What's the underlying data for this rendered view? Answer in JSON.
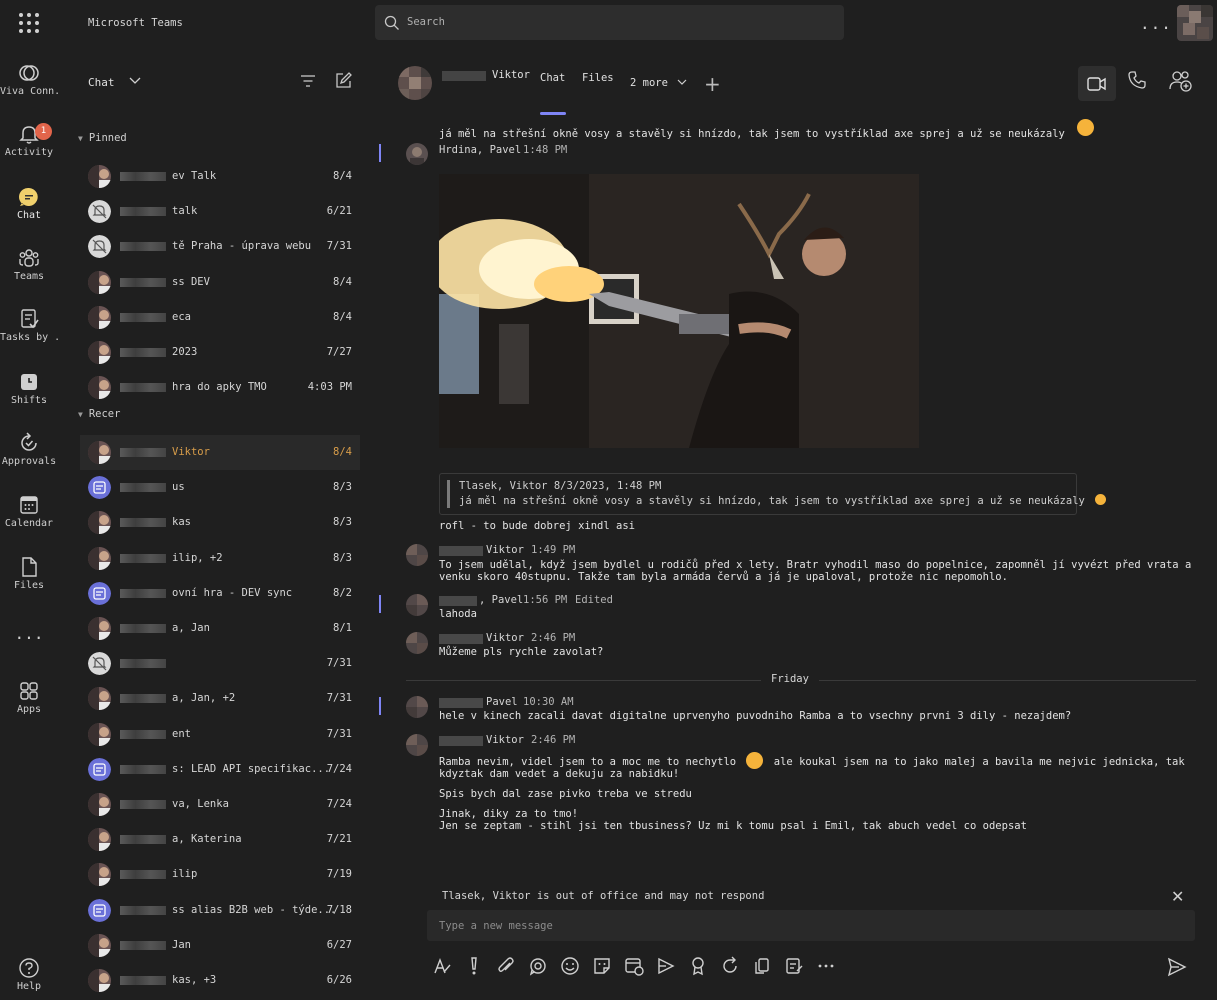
{
  "app": {
    "name": "Microsoft Teams"
  },
  "search": {
    "placeholder": "Search"
  },
  "topbar": {
    "more": "..."
  },
  "rail": {
    "viva": "Viva Conn...",
    "activity": "Activity",
    "activity_badge": "1",
    "chat": "Chat",
    "teams": "Teams",
    "tasks": "Tasks by ...",
    "shifts": "Shifts",
    "approvals": "Approvals",
    "calendar": "Calendar",
    "files": "Files",
    "more": "...",
    "apps": "Apps",
    "help": "Help"
  },
  "chat_list": {
    "header": "Chat",
    "pinned_label": "Pinned",
    "recent_label": "Recer",
    "pinned": [
      {
        "name": "ev Talk",
        "date": "8/4"
      },
      {
        "name": "talk",
        "date": "6/21"
      },
      {
        "name": "tě Praha - úprava webu",
        "date": "7/31"
      },
      {
        "name": "ss DEV",
        "date": "8/4"
      },
      {
        "name": "eca",
        "date": "8/4"
      },
      {
        "name": "2023",
        "date": "7/27"
      },
      {
        "name": "hra do apky TMO",
        "date": "4:03 PM"
      }
    ],
    "recent": [
      {
        "name": "Viktor",
        "date": "8/4"
      },
      {
        "name": "us",
        "date": "8/3"
      },
      {
        "name": "kas",
        "date": "8/3"
      },
      {
        "name": "ilip, +2",
        "date": "8/3"
      },
      {
        "name": "ovní hra - DEV sync",
        "date": "8/2"
      },
      {
        "name": "a, Jan",
        "date": "8/1"
      },
      {
        "name": "",
        "date": "7/31"
      },
      {
        "name": "a, Jan, +2",
        "date": "7/31"
      },
      {
        "name": "ent",
        "date": "7/31"
      },
      {
        "name": "s: LEAD API specifikac...",
        "date": "7/24"
      },
      {
        "name": "va, Lenka",
        "date": "7/24"
      },
      {
        "name": "a, Katerina",
        "date": "7/21"
      },
      {
        "name": "ilip",
        "date": "7/19"
      },
      {
        "name": "ss alias B2B web - týde...",
        "date": "7/18"
      },
      {
        "name": "Jan",
        "date": "6/27"
      },
      {
        "name": "kas, +3",
        "date": "6/26"
      }
    ]
  },
  "chat_header": {
    "name": "Viktor",
    "tabs": {
      "chat": "Chat",
      "files": "Files",
      "more": "2 more"
    }
  },
  "messages": {
    "top_line": "já měl na střešní okně vosy a stavěly si hnízdo, tak jsem to vystříklad axe sprej a už se neukázaly",
    "m1": {
      "sender": "Hrdina, Pavel",
      "time": "1:48 PM"
    },
    "quote": {
      "head": "Tlasek, Viktor 8/3/2023, 1:48 PM",
      "body": "já měl na střešní okně vosy a stavěly si hnízdo, tak jsem to vystříklad axe sprej a už se neukázaly"
    },
    "m1_text": "rofl - to bude dobrej xindl asi",
    "m2": {
      "sender": "Viktor",
      "time": "1:49 PM",
      "line1": "To jsem udělal, když jsem bydlel u rodičů před x lety. Bratr vyhodil maso do popelnice, zapomněl jí vyvézt před vrata a",
      "line2": "venku skoro 40stupnu. Takže tam byla armáda červů a já je upaloval, protože nic nepomohlo."
    },
    "m3": {
      "sender": ", Pavel",
      "time": "1:56 PM",
      "edited": "Edited",
      "text": "lahoda"
    },
    "m4": {
      "sender": "Viktor",
      "time": "2:46 PM",
      "text": "Můžeme pls rychle zavolat?"
    },
    "day": "Friday",
    "m5": {
      "sender": "Pavel",
      "time": "10:30 AM",
      "text": "hele v kinech zacali davat digitalne uprvenyho puvodniho Ramba a to vsechny prvni 3 dily - nezajdem?"
    },
    "m6": {
      "sender": "Viktor",
      "time": "2:46 PM",
      "line1a": "Ramba nevim, videl jsem to a moc me to nechytlo",
      "line1b": "ale koukal jsem na to jako malej a bavila me nejvic jednicka, tak",
      "line2": "kdyztak dam vedet a dekuju za nabidku!",
      "line3": "Spis bych dal zase pivko treba ve stredu",
      "line4": "Jinak, diky za to tmo!",
      "line5": "Jen se zeptam - stihl jsi ten tbusiness? Uz mi k tomu psal i Emil, tak abuch vedel co odepsat"
    }
  },
  "ooo_notice": "Tlasek, Viktor is out of office and may not respond",
  "compose": {
    "placeholder": "Type a new message"
  },
  "colors": {
    "accent": "#7f85f5",
    "highlight": "#d89d4a",
    "badge": "#e2654b"
  }
}
